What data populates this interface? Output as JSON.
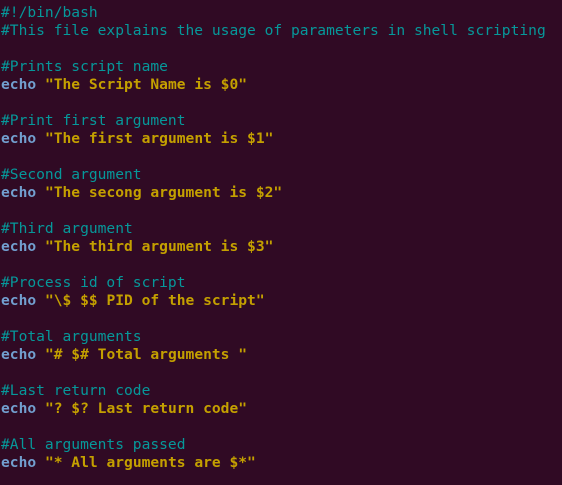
{
  "colors": {
    "background": "#300a24",
    "comment": "#06989a",
    "keyword": "#729fcf",
    "string": "#c4a000"
  },
  "lines": [
    {
      "type": "comment",
      "text": "#!/bin/bash"
    },
    {
      "type": "comment",
      "text": "#This file explains the usage of parameters in shell scripting"
    },
    {
      "type": "blank",
      "text": ""
    },
    {
      "type": "comment",
      "text": "#Prints script name"
    },
    {
      "type": "code",
      "keyword": "echo",
      "string": "\"The Script Name is $0\""
    },
    {
      "type": "blank",
      "text": ""
    },
    {
      "type": "comment",
      "text": "#Print first argument"
    },
    {
      "type": "code",
      "keyword": "echo",
      "string": "\"The first argument is $1\""
    },
    {
      "type": "blank",
      "text": ""
    },
    {
      "type": "comment",
      "text": "#Second argument"
    },
    {
      "type": "code",
      "keyword": "echo",
      "string": "\"The secong argument is $2\""
    },
    {
      "type": "blank",
      "text": ""
    },
    {
      "type": "comment",
      "text": "#Third argument"
    },
    {
      "type": "code",
      "keyword": "echo",
      "string": "\"The third argument is $3\""
    },
    {
      "type": "blank",
      "text": ""
    },
    {
      "type": "comment",
      "text": "#Process id of script"
    },
    {
      "type": "code",
      "keyword": "echo",
      "string": "\"\\$ $$ PID of the script\""
    },
    {
      "type": "blank",
      "text": ""
    },
    {
      "type": "comment",
      "text": "#Total arguments"
    },
    {
      "type": "code",
      "keyword": "echo",
      "string": "\"# $# Total arguments \""
    },
    {
      "type": "blank",
      "text": ""
    },
    {
      "type": "comment",
      "text": "#Last return code"
    },
    {
      "type": "code",
      "keyword": "echo",
      "string": "\"? $? Last return code\""
    },
    {
      "type": "blank",
      "text": ""
    },
    {
      "type": "comment",
      "text": "#All arguments passed"
    },
    {
      "type": "code",
      "keyword": "echo",
      "string": "\"* All arguments are $*\""
    }
  ]
}
